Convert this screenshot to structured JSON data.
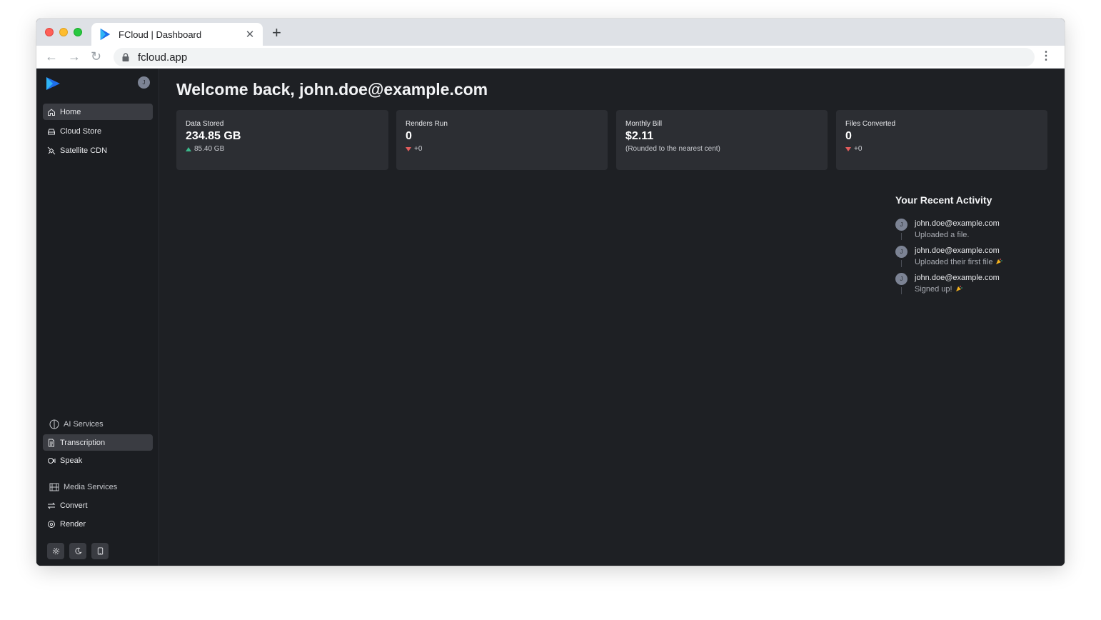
{
  "browser": {
    "tab_title": "FCloud | Dashboard",
    "url": "fcloud.app"
  },
  "sidebar": {
    "avatar_initial": "J",
    "nav": [
      {
        "label": "Home",
        "icon": "home-icon",
        "active": true
      },
      {
        "label": "Cloud Store",
        "icon": "drive-icon"
      },
      {
        "label": "Satellite CDN",
        "icon": "satellite-icon"
      }
    ],
    "ai_section": {
      "label": "AI Services",
      "icon": "ai-icon"
    },
    "ai_items": [
      {
        "label": "Transcription",
        "icon": "document-icon",
        "active": true
      },
      {
        "label": "Speak",
        "icon": "speak-icon"
      }
    ],
    "media_section": {
      "label": "Media Services",
      "icon": "film-icon"
    },
    "media_items": [
      {
        "label": "Convert",
        "icon": "convert-icon"
      },
      {
        "label": "Render",
        "icon": "render-icon"
      }
    ],
    "footer_buttons": [
      "settings-icon",
      "moon-icon",
      "tablet-icon"
    ]
  },
  "main": {
    "welcome": "Welcome back, john.doe@example.com",
    "stats": [
      {
        "label": "Data Stored",
        "value": "234.85 GB",
        "delta": "85.40 GB",
        "trend": "up"
      },
      {
        "label": "Renders Run",
        "value": "0",
        "delta": "+0",
        "trend": "down"
      },
      {
        "label": "Monthly Bill",
        "value": "$2.11",
        "delta": "(Rounded to the nearest cent)",
        "trend": "none"
      },
      {
        "label": "Files Converted",
        "value": "0",
        "delta": "+0",
        "trend": "down"
      }
    ],
    "activity": {
      "title": "Your Recent Activity",
      "items": [
        {
          "initial": "J",
          "user": "john.doe@example.com",
          "text": "Uploaded a file.",
          "emoji": false
        },
        {
          "initial": "J",
          "user": "john.doe@example.com",
          "text": "Uploaded their first file",
          "emoji": true
        },
        {
          "initial": "J",
          "user": "john.doe@example.com",
          "text": "Signed up!",
          "emoji": true
        }
      ]
    }
  },
  "colors": {
    "background": "#1e2024",
    "sidebar": "#1b1d21",
    "card": "#2c2e33",
    "up": "#3bb88b",
    "down": "#e25c5c"
  }
}
